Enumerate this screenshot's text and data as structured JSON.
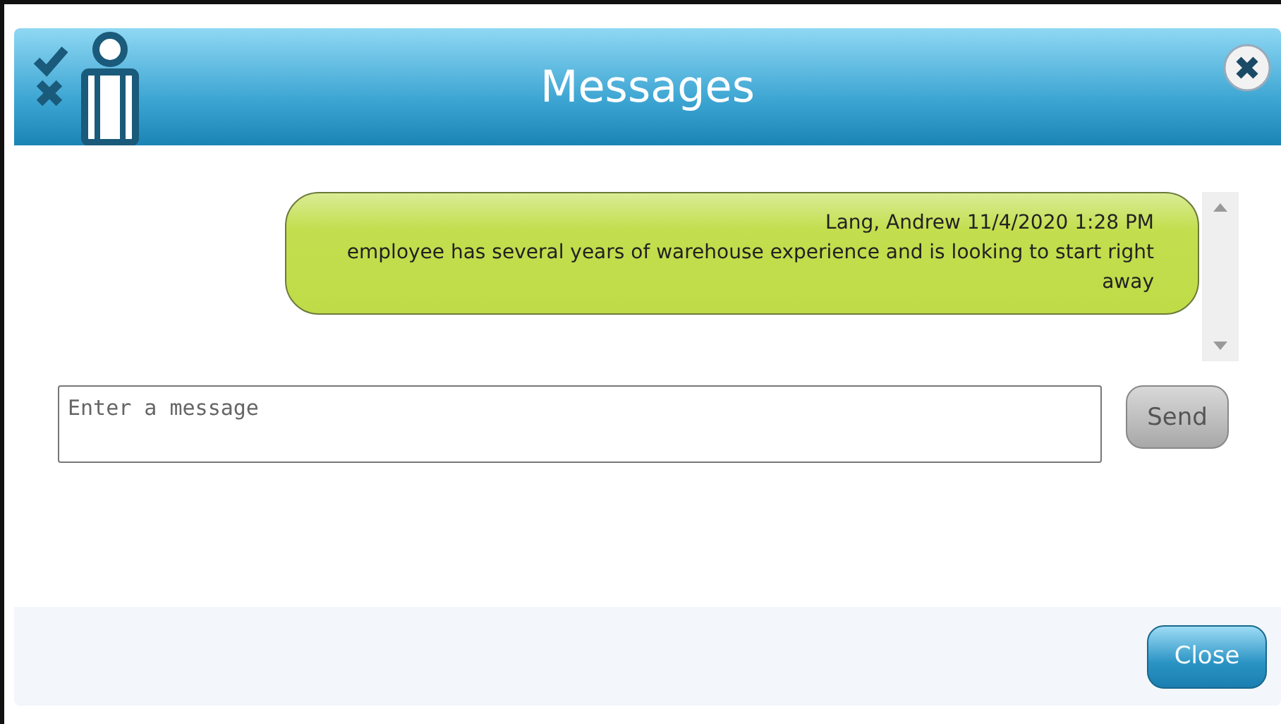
{
  "window": {
    "title": "Messages"
  },
  "messages": [
    {
      "header": "Lang, Andrew 11/4/2020 1:28 PM",
      "text": "employee has several years of warehouse experience and is looking to start right away"
    }
  ],
  "composer": {
    "placeholder": "Enter a message",
    "send_button": {
      "label": "Send",
      "disabled": true
    }
  },
  "footer": {
    "buttons": [
      "Close"
    ]
  }
}
